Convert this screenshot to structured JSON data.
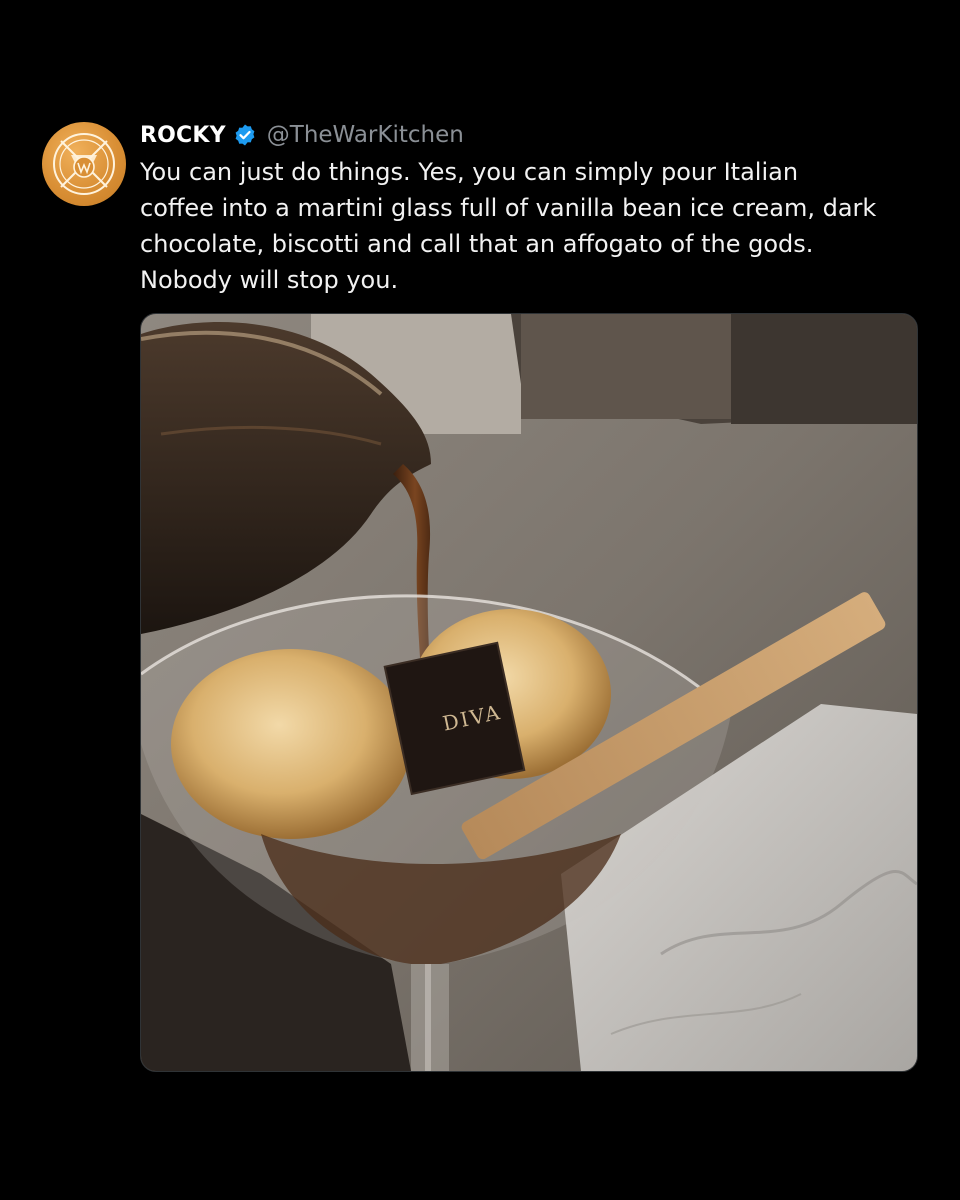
{
  "tweet": {
    "avatar_icon": "war-kitchen-logo-icon",
    "display_name": "ROCKY",
    "verified_icon": "verified-badge-icon",
    "handle": "@TheWarKitchen",
    "text": "You can just do things. Yes, you can simply pour Italian\ncoffee into a martini glass full of vanilla bean ice cream, dark\nchocolate, biscotti and call that an affogato of the gods.\nNobody will stop you.",
    "media": {
      "chocolate_label": "DIVA"
    }
  },
  "colors": {
    "background": "#000000",
    "avatar": "#d98f35",
    "verified": "#1d9bf0",
    "handle": "#8b9096"
  }
}
